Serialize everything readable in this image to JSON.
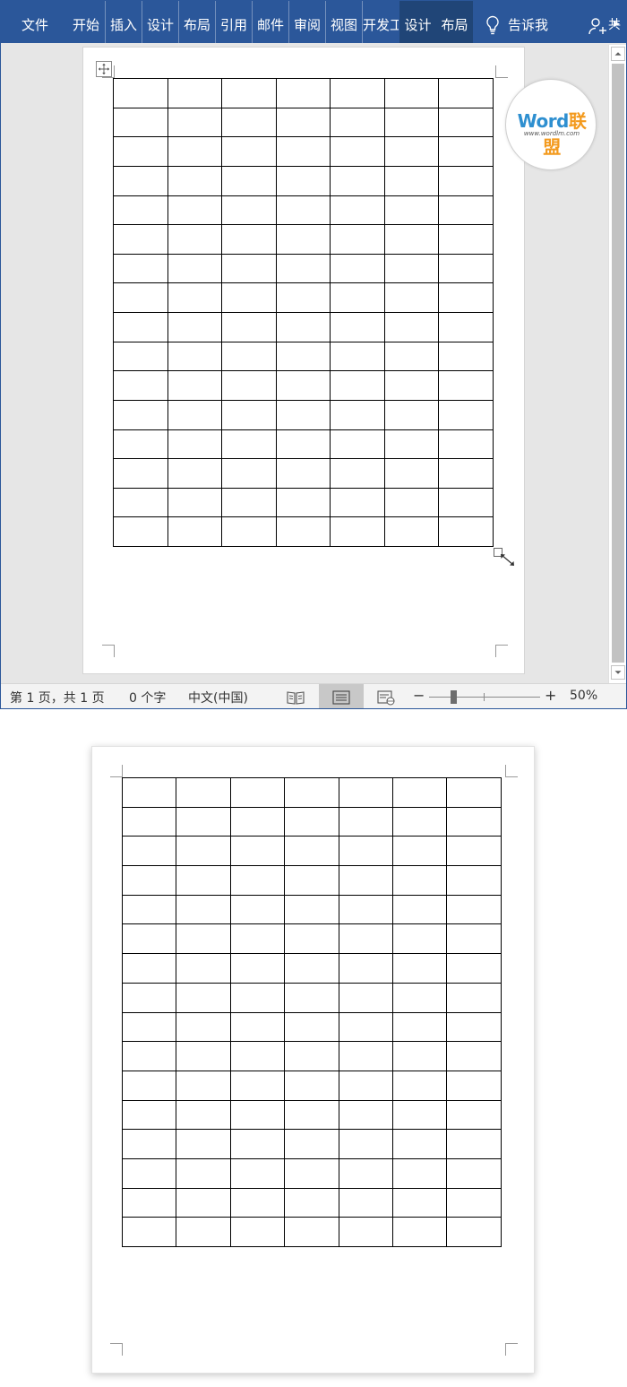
{
  "ribbon": {
    "tabs": [
      "文件",
      "开始",
      "插入",
      "设计",
      "布局",
      "引用",
      "邮件",
      "审阅",
      "视图",
      "开发工",
      "设计",
      "布局"
    ],
    "tell_me": "告诉我",
    "share_label": "共",
    "color": "#2b579a"
  },
  "logo": {
    "word": "Word",
    "cn": "联盟",
    "url": "www.wordlm.com"
  },
  "table": {
    "rows": 16,
    "cols": 7
  },
  "status": {
    "page": "第 1 页，共 1 页",
    "words": "0 个字",
    "language": "中文(中国)",
    "zoom_minus": "−",
    "zoom_plus": "+",
    "zoom": "50%",
    "zoom_fraction": 0.5
  }
}
